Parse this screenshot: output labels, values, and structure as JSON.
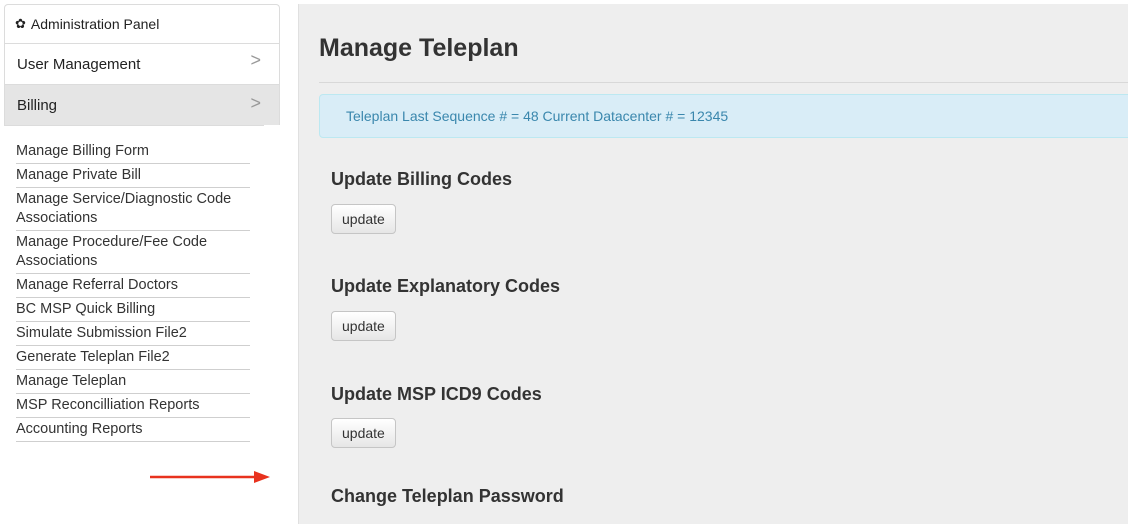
{
  "sidebar": {
    "header": {
      "icon": "gear-icon",
      "title": "Administration Panel"
    },
    "nav": [
      {
        "label": "User Management",
        "chevron": ">"
      },
      {
        "label": "Billing",
        "chevron": ">"
      }
    ],
    "billing_items": [
      "Manage Billing Form",
      "Manage Private Bill",
      "Manage Service/Diagnostic Code Associations",
      "Manage Procedure/Fee Code Associations",
      "Manage Referral Doctors",
      "BC MSP Quick Billing",
      "Simulate Submission File2",
      "Generate Teleplan File2",
      "Manage Teleplan",
      "MSP Reconcilliation Reports",
      "Accounting Reports"
    ],
    "annotation_arrow_color": "#e8321e"
  },
  "main": {
    "title": "Manage Teleplan",
    "alert": "Teleplan Last Sequence # = 48 Current Datacenter # = 12345",
    "sections": [
      {
        "title": "Update Billing Codes",
        "button": "update"
      },
      {
        "title": "Update Explanatory Codes",
        "button": "update"
      },
      {
        "title": "Update MSP ICD9 Codes",
        "button": "update"
      },
      {
        "title": "Change Teleplan Password"
      }
    ]
  },
  "colors": {
    "alert_bg": "#d9edf7",
    "alert_text": "#3a87ad",
    "active_nav_bg": "#e5e5e5",
    "main_bg": "#eeeeee"
  }
}
